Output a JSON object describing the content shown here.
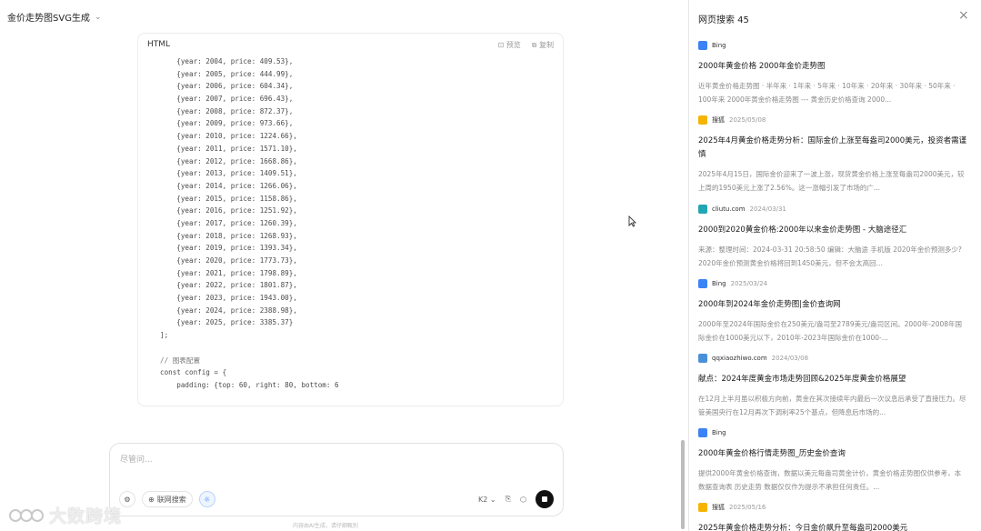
{
  "header": {
    "title": "金价走势图SVG生成"
  },
  "code_panel": {
    "lang": "HTML",
    "preview_label": "预览",
    "copy_label": "复制",
    "lines": [
      "    {year: 2004, price: 409.53},",
      "    {year: 2005, price: 444.99},",
      "    {year: 2006, price: 604.34},",
      "    {year: 2007, price: 696.43},",
      "    {year: 2008, price: 872.37},",
      "    {year: 2009, price: 973.66},",
      "    {year: 2010, price: 1224.66},",
      "    {year: 2011, price: 1571.10},",
      "    {year: 2012, price: 1668.86},",
      "    {year: 2013, price: 1409.51},",
      "    {year: 2014, price: 1266.06},",
      "    {year: 2015, price: 1158.86},",
      "    {year: 2016, price: 1251.92},",
      "    {year: 2017, price: 1260.39},",
      "    {year: 2018, price: 1268.93},",
      "    {year: 2019, price: 1393.34},",
      "    {year: 2020, price: 1773.73},",
      "    {year: 2021, price: 1798.89},",
      "    {year: 2022, price: 1801.87},",
      "    {year: 2023, price: 1943.00},",
      "    {year: 2024, price: 2388.98},",
      "    {year: 2025, price: 3385.37}",
      "];",
      "",
      "// 图表配置",
      "const config = {",
      "    padding: {top: 60, right: 80, bottom: 6"
    ]
  },
  "input": {
    "placeholder": "尽管问...",
    "search_label": "联网搜索",
    "model_label": "K2",
    "disclaimer": "内容由AI生成，请仔细甄别"
  },
  "watermark": {
    "text": "大数跨境"
  },
  "right_panel": {
    "title": "网页搜索 45",
    "results": [
      {
        "source": "Bing",
        "date": "",
        "icon_color": "#3b82f6",
        "title": "2000年黄金价格 2000年金价走势图",
        "snippet": "近年黄金价格走势图 · 半年来 · 1年来 · 5年来 · 10年来 · 20年来 · 30年来 · 50年来 · 100年来 2000年黄金价格走势图 --- 黄金历史价格查询 2000..."
      },
      {
        "source": "搜狐",
        "date": "2025/05/08",
        "icon_color": "#f5b400",
        "title": "2025年4月黄金价格走势分析：国际金价上涨至每盎司2000美元，投资者需谨慎",
        "snippet": "2025年4月15日，国际金价迎来了一波上涨，现货黄金价格上涨至每盎司2000美元，较上周的1950美元上涨了2.56%。这一涨幅引发了市场的广..."
      },
      {
        "source": "cliutu.com",
        "date": "2024/03/31",
        "icon_color": "#22a6b3",
        "title": "2000到2020黄金价格:2000年以来金价走势图 - 大脑途径汇",
        "snippet": "来源：整理时间：2024-03-31 20:58:50 编辑：大脑途 手机版 2020年金价预测多少?2020年金价预测黄金价格将回到1450美元，但不会太高回..."
      },
      {
        "source": "Bing",
        "date": "2025/03/24",
        "icon_color": "#3b82f6",
        "title": "2000年到2024年金价走势图|金价查询网",
        "snippet": "2000年至2024年国际金价在250美元/盎司至2789美元/盎司区间。2000年-2008年国际金价在1000美元以下，2010年-2023年国际金价在1000-..."
      },
      {
        "source": "qqxiaozhiwo.com",
        "date": "2024/03/08",
        "icon_color": "#4a90d9",
        "title": "献点：2024年度黄金市场走势回顾&2025年度黄金价格展望",
        "snippet": "在12月上半月虽以积极方向前，黄金在其次接续年内最后一次议息后承受了直接压力。尽管美国央行在12月再次下调利率25个基点，但降息后市场的..."
      },
      {
        "source": "Bing",
        "date": "",
        "icon_color": "#3b82f6",
        "title": "2000年黄金价格行情走势图_历史金价查询",
        "snippet": "提供2000年黄金价格查询，数据以美元每盎司黄金计价，黄金价格走势图仅供参考，本数据查询表 历史走势 数据仅仅作为提示不承担任何责任。..."
      },
      {
        "source": "搜狐",
        "date": "2025/05/16",
        "icon_color": "#f5b400",
        "title": "2025年黄金价格走势分析：今日金价飙升至每盎司2000美元",
        "snippet": ""
      }
    ]
  }
}
